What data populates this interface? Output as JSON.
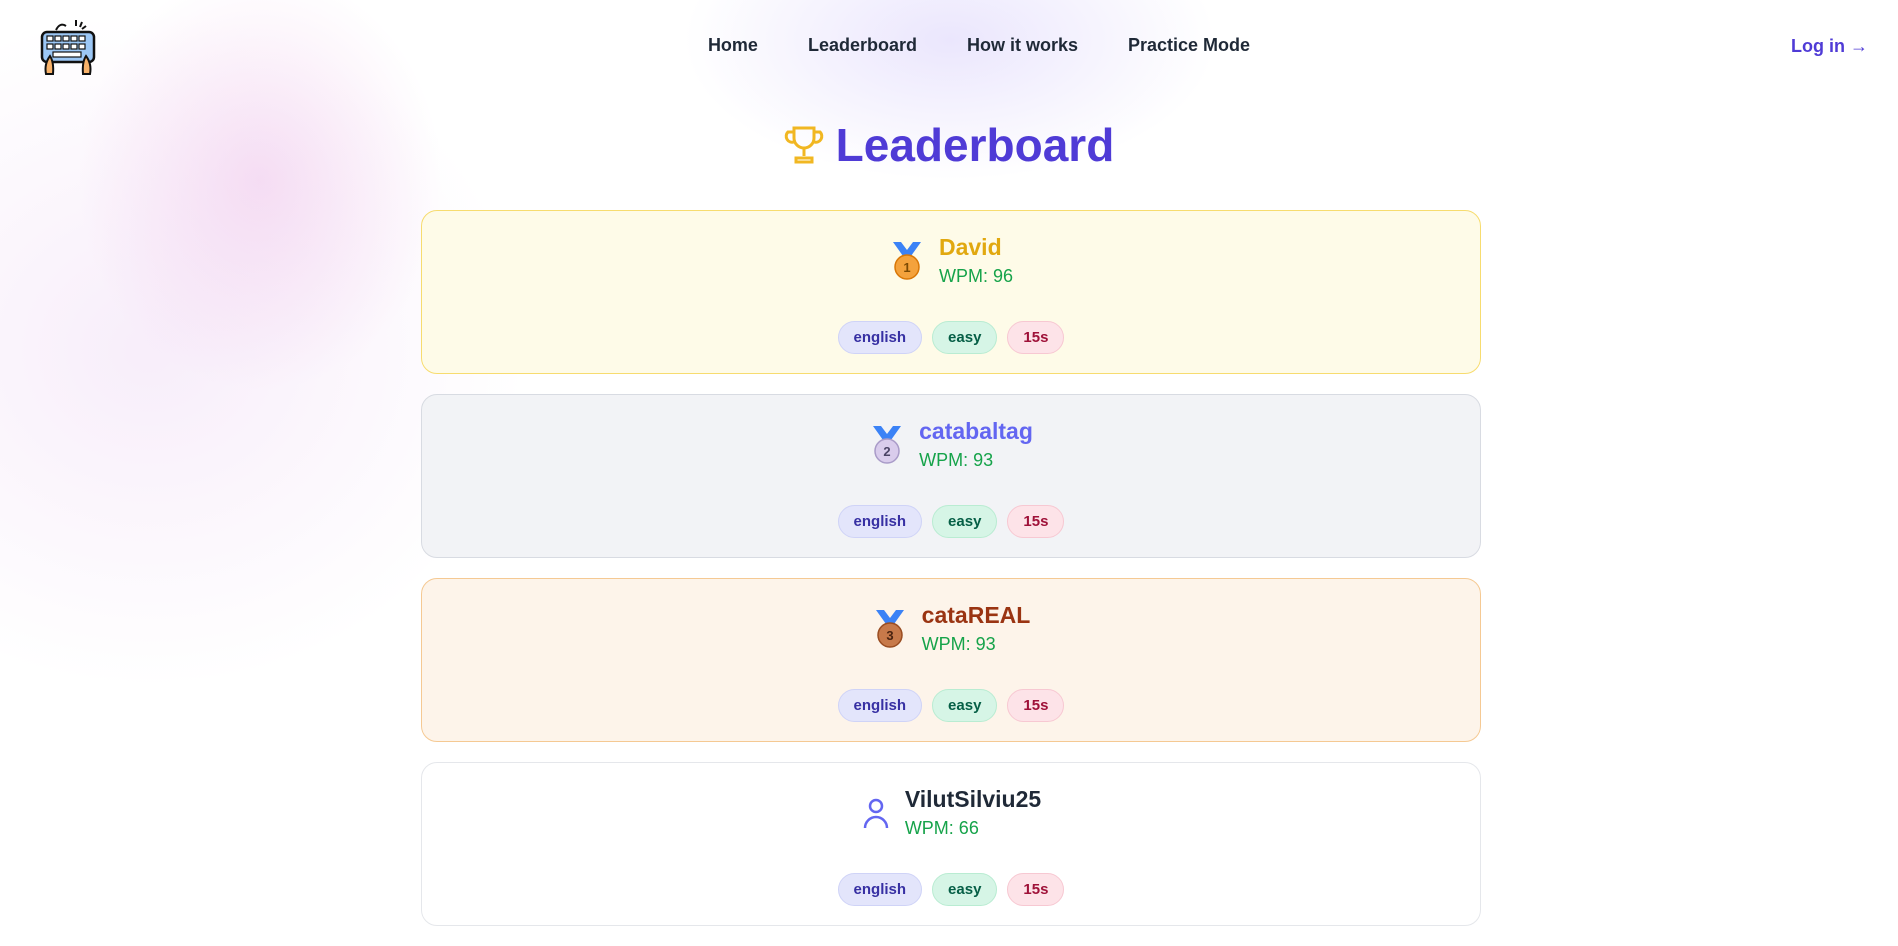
{
  "header": {
    "logo_icon": "keyboard-hands-icon",
    "nav": [
      {
        "label": "Home"
      },
      {
        "label": "Leaderboard"
      },
      {
        "label": "How it works"
      },
      {
        "label": "Practice Mode"
      }
    ],
    "login_label": "Log in →"
  },
  "page": {
    "title": "Leaderboard",
    "title_icon": "trophy-icon"
  },
  "entries": [
    {
      "rank": "1",
      "name": "David",
      "wpm": "WPM: 96",
      "tags": [
        "english",
        "easy",
        "15s"
      ],
      "icon": "gold-medal-icon",
      "name_color": "#e1a80f"
    },
    {
      "rank": "2",
      "name": "catabaltag",
      "wpm": "WPM: 93",
      "tags": [
        "english",
        "easy",
        "15s"
      ],
      "icon": "silver-medal-icon",
      "name_color": "#6366f1"
    },
    {
      "rank": "3",
      "name": "cataREAL",
      "wpm": "WPM: 93",
      "tags": [
        "english",
        "easy",
        "15s"
      ],
      "icon": "bronze-medal-icon",
      "name_color": "#9a3412"
    },
    {
      "rank": "",
      "name": "VilutSilviu25",
      "wpm": "WPM: 66",
      "tags": [
        "english",
        "easy",
        "15s"
      ],
      "icon": "user-icon",
      "name_color": "#1f2937"
    }
  ],
  "colors": {
    "accent": "#4f3bd6",
    "wpm": "#16a34a"
  }
}
